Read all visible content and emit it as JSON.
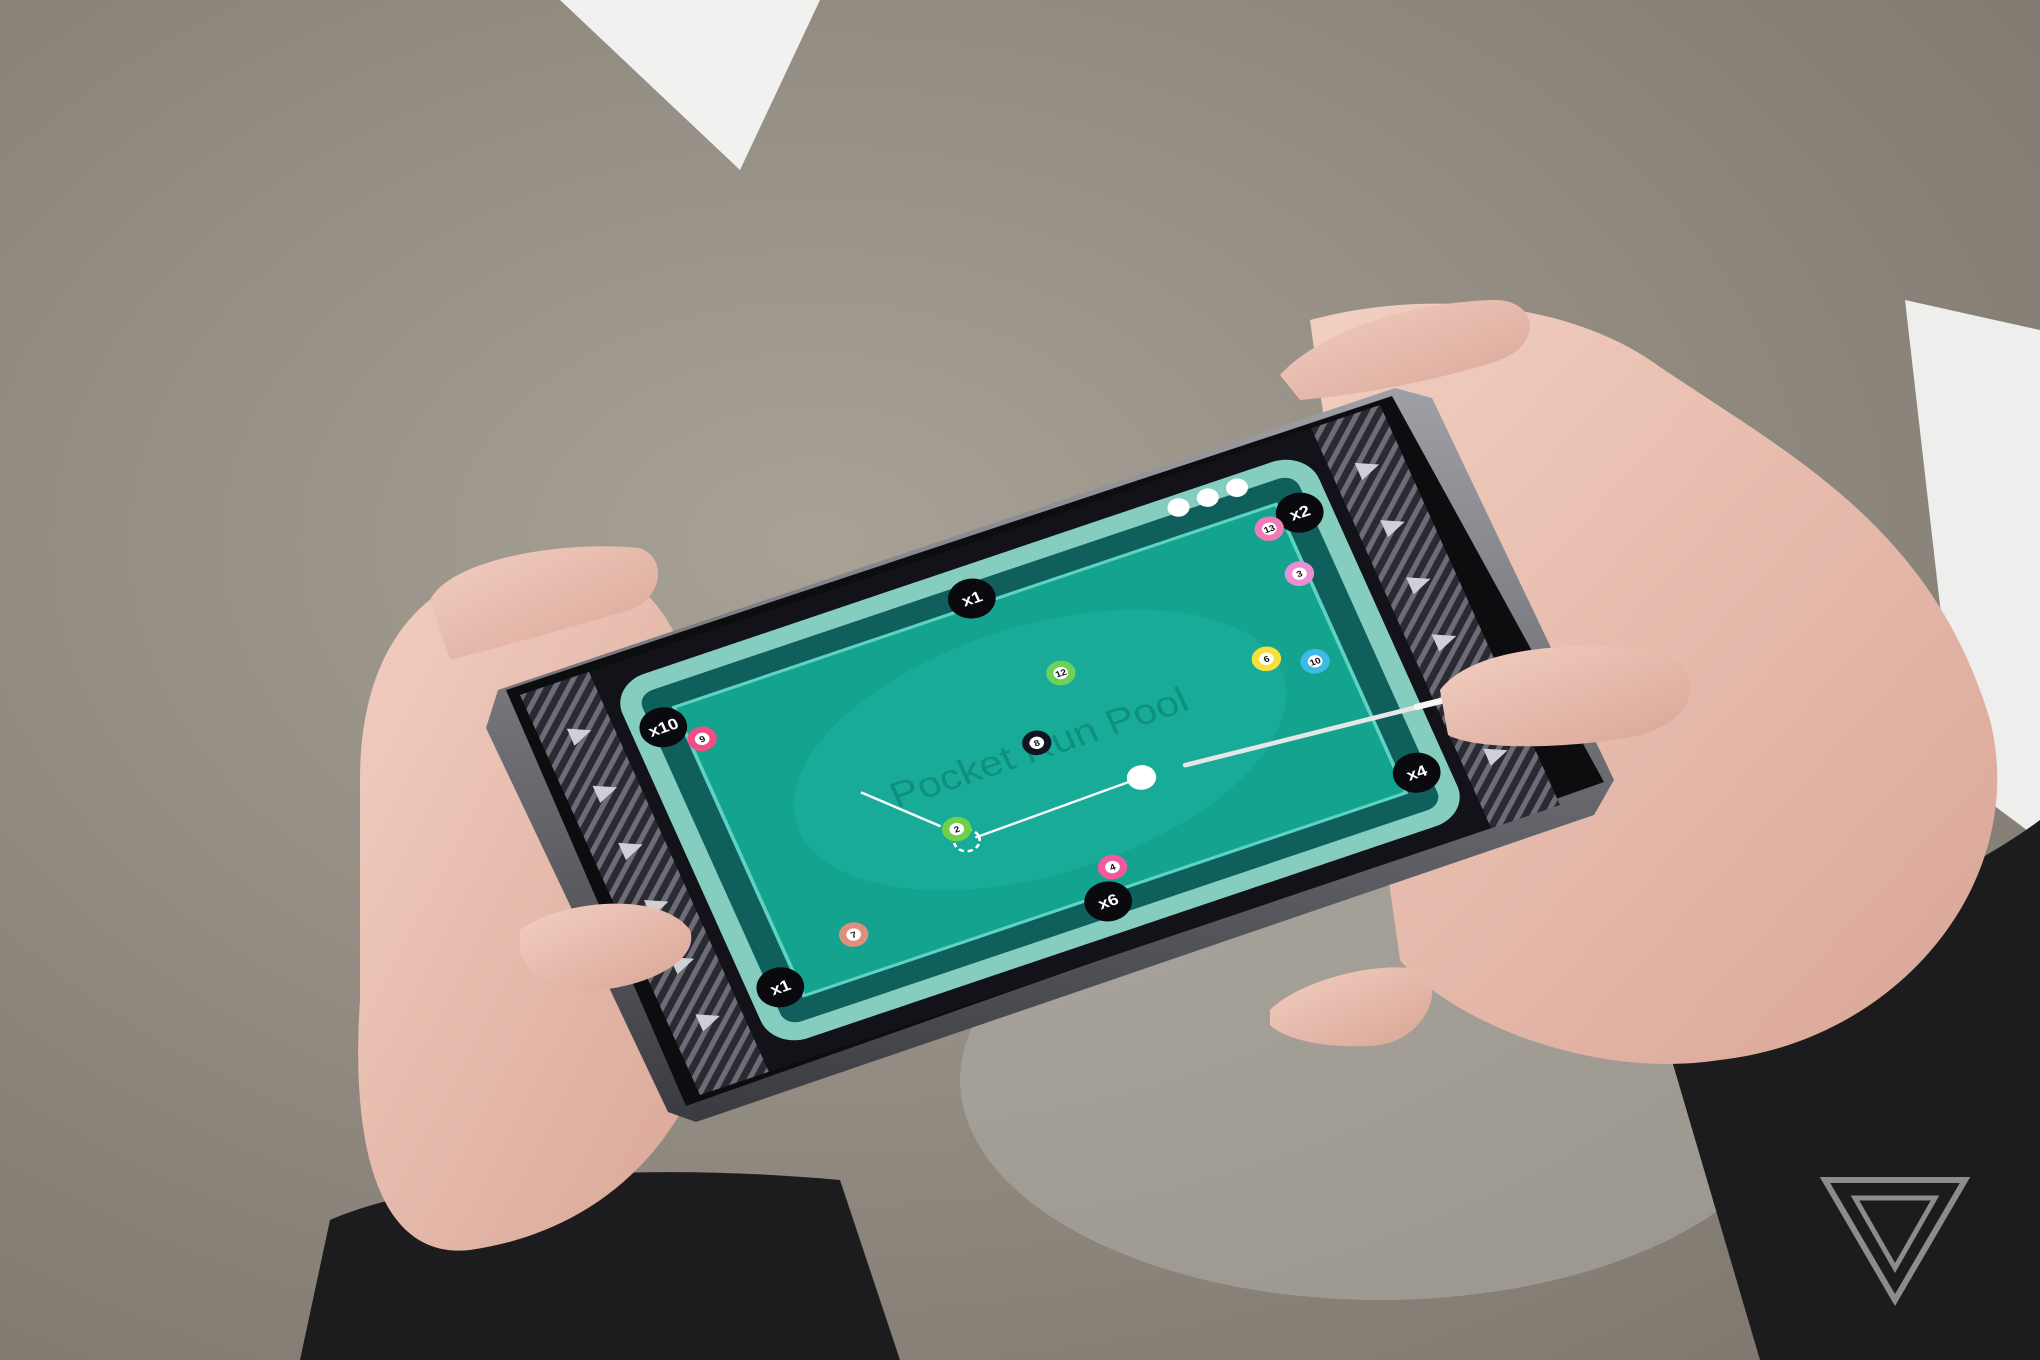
{
  "colors": {
    "felt": "#13a38f",
    "felt_light": "#1fb9a4",
    "rail": "#85cdbf",
    "cushion": "#0f5f5c",
    "bumper_dark": "#0c3f44",
    "side_panel": "#2a2a33",
    "pocket": "#0a0a0e",
    "phone_body": "#0d0d10",
    "floor": "#9c958b"
  },
  "game": {
    "watermark": "Pocket Run Pool",
    "lives": 3,
    "pockets": [
      {
        "label": "x10"
      },
      {
        "label": "x1"
      },
      {
        "label": "x2"
      },
      {
        "label": "x4"
      },
      {
        "label": "x6"
      },
      {
        "label": "x1"
      }
    ],
    "balls": [
      {
        "number": "13",
        "color": "#f07ab6"
      },
      {
        "number": "3",
        "color": "#e98fd6"
      },
      {
        "number": "12",
        "color": "#6fd05a"
      },
      {
        "number": "9",
        "color": "#f04f86"
      },
      {
        "number": "8",
        "color": "#12151f"
      },
      {
        "number": "6",
        "color": "#f6e13c"
      },
      {
        "number": "10",
        "color": "#3fb9e6"
      },
      {
        "number": "2",
        "color": "#72cf49"
      },
      {
        "number": "7",
        "color": "#e0907a"
      },
      {
        "number": "4",
        "color": "#f25a9d"
      }
    ]
  }
}
